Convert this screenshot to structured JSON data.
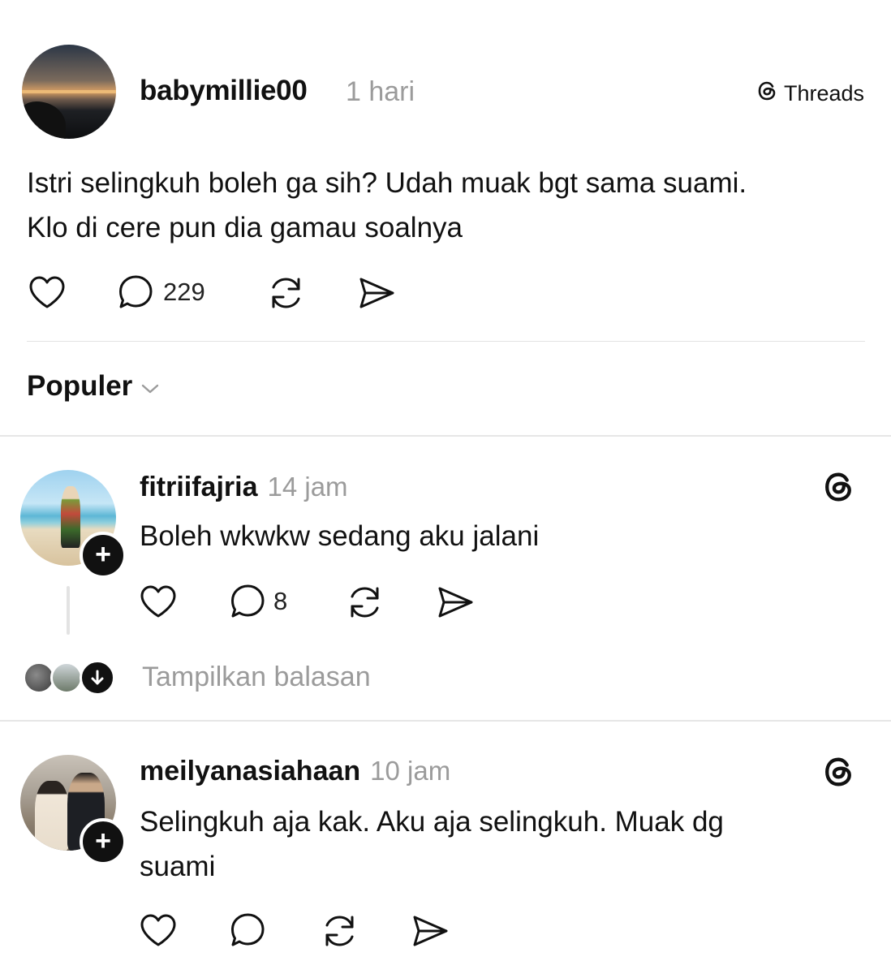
{
  "post": {
    "username": "babymillie00",
    "time": "1 hari",
    "badge_label": "Threads",
    "text_line1": "Istri selingkuh boleh ga sih? Udah muak bgt sama suami.",
    "text_line2": "Klo di cere pun dia gamau soalnya",
    "reply_count": "229"
  },
  "sort": {
    "label": "Populer"
  },
  "replies": [
    {
      "username": "fitriifajria",
      "time": "14 jam",
      "text": "Boleh wkwkw sedang aku jalani",
      "reply_count": "8",
      "show_replies_label": "Tampilkan balasan"
    },
    {
      "username": "meilyanasiahaan",
      "time": "10 jam",
      "text_line1": "Selingkuh aja kak. Aku aja selingkuh. Muak dg",
      "text_line2": "suami",
      "reply_count": ""
    }
  ],
  "icons": {
    "like": "heart-icon",
    "reply": "speech-bubble-icon",
    "repost": "repost-icon",
    "share": "send-icon",
    "threads": "threads-logo-icon",
    "follow": "plus-icon",
    "sort": "chevron-down-icon",
    "expand": "arrow-down-icon"
  },
  "colors": {
    "text": "#111111",
    "muted": "#9b9b9b",
    "divider": "#e3e3e3",
    "badge": "#111111"
  }
}
